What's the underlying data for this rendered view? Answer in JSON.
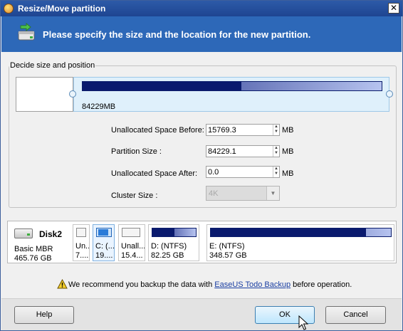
{
  "window": {
    "title": "Resize/Move partition",
    "close_label": "✕"
  },
  "banner": {
    "text": "Please specify the size and the location for the new partition."
  },
  "layout_group": {
    "label": "Decide size and position",
    "partition_size_text": "84229MB",
    "used_fraction": 0.53
  },
  "form": {
    "unalloc_before": {
      "label": "Unallocated Space Before:",
      "value": "15769.3",
      "unit": "MB"
    },
    "partition_size": {
      "label": "Partition Size :",
      "value": "84229.1",
      "unit": "MB"
    },
    "unalloc_after": {
      "label": "Unallocated Space After:",
      "value": "0.0",
      "unit": "MB"
    },
    "cluster_size": {
      "label": "Cluster Size :",
      "value": "4K"
    }
  },
  "disk": {
    "name": "Disk2",
    "type": "Basic MBR",
    "size": "465.76 GB",
    "partitions": [
      {
        "l1": "Un...",
        "l2": "7....",
        "kind": "empty"
      },
      {
        "l1": "C: (...",
        "l2": "19....",
        "kind": "cdrive"
      },
      {
        "l1": "Unall...",
        "l2": "15.4...",
        "kind": "empty"
      },
      {
        "l1": "D: (NTFS)",
        "l2": "82.25 GB",
        "kind": "blue",
        "used_fraction": 0.5
      },
      {
        "l1": "E: (NTFS)",
        "l2": "348.57 GB",
        "kind": "blue",
        "used_fraction": 0.86
      }
    ]
  },
  "warning": {
    "before": "We recommend you backup the data with ",
    "link": "EaseUS Todo Backup",
    "after": " before operation."
  },
  "buttons": {
    "help": "Help",
    "ok": "OK",
    "cancel": "Cancel"
  }
}
